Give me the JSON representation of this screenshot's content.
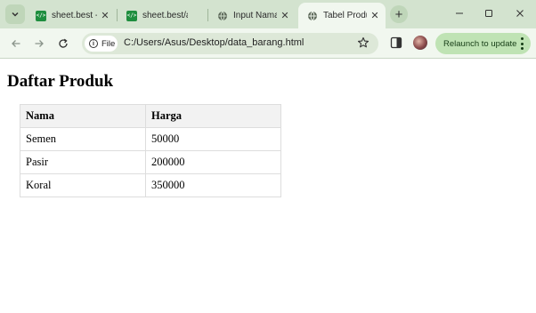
{
  "browser": {
    "tabs": [
      {
        "title": "sheet.best - ",
        "icon": "sheet-favicon"
      },
      {
        "title": "sheet.best/a",
        "icon": "sheet-favicon"
      },
      {
        "title": "Input Nama",
        "icon": "globe-icon"
      },
      {
        "title": "Tabel Produk",
        "icon": "globe-icon",
        "active": true
      }
    ],
    "address": {
      "chip_label": "File",
      "url": "C:/Users/Asus/Desktop/data_barang.html"
    },
    "relaunch_label": "Relaunch to update"
  },
  "page": {
    "heading": "Daftar Produk",
    "table": {
      "headers": [
        "Nama",
        "Harga"
      ],
      "rows": [
        [
          "Semen",
          "50000"
        ],
        [
          "Pasir",
          "200000"
        ],
        [
          "Koral",
          "350000"
        ]
      ]
    }
  }
}
